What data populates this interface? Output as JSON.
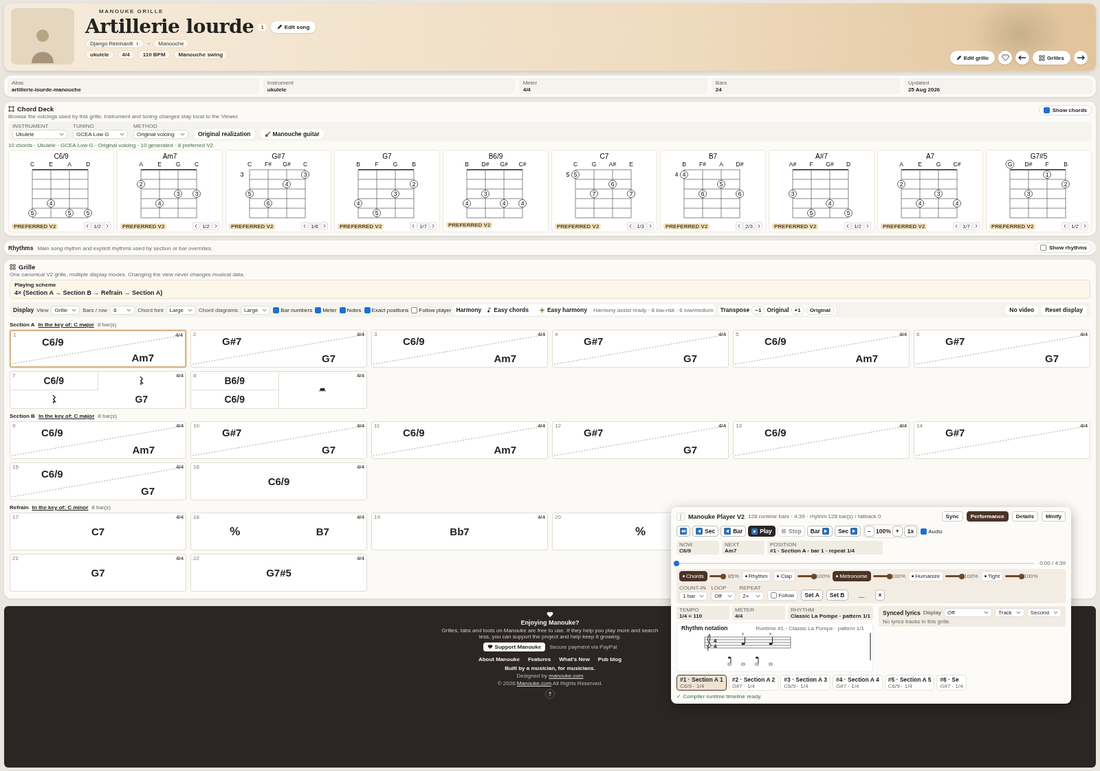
{
  "header": {
    "kicker": "MANOUKE GRILLE",
    "title": "Artillerie lourde",
    "version": "1",
    "edit_song": "Edit song",
    "artist": "Django Reinhardt",
    "artist_info": "i",
    "style": "Manouche",
    "tags": [
      "ukulele",
      "4/4",
      "110 BPM",
      "Manouche swing"
    ],
    "edit_grille": "Edit grille",
    "favorite": false,
    "grilles": "Grilles"
  },
  "meta": [
    {
      "label": "Alias",
      "value": "artillerie-lourde-manouche"
    },
    {
      "label": "Instrument",
      "value": "ukulele"
    },
    {
      "label": "Meter",
      "value": "4/4"
    },
    {
      "label": "Bars",
      "value": "24"
    },
    {
      "label": "Updated",
      "value": "25 Aug 2026"
    }
  ],
  "chord_deck": {
    "title": "Chord Deck",
    "description": "Browse the voicings used by this grille. Instrument and tuning changes stay local to the Viewer.",
    "show_chords": {
      "label": "Show chords",
      "checked": true
    },
    "filters": [
      {
        "label": "INSTRUMENT",
        "value": "Ukulele"
      },
      {
        "label": "TUNING",
        "value": "GCEA Low G"
      },
      {
        "label": "METHOD",
        "value": "Original voicing"
      }
    ],
    "buttons": [
      "Original realization",
      "Manouche guitar"
    ],
    "summary": "10 chords · Ukulele · GCEA Low G · Original voicing · 10 generated · 8 preferred V2",
    "chords": [
      {
        "name": "C6/9",
        "strings": [
          {
            "note": "C",
            "open": false,
            "fret": "5"
          },
          {
            "note": "E",
            "open": false,
            "fret": "4"
          },
          {
            "note": "A",
            "open": false,
            "fret": "5"
          },
          {
            "note": "D",
            "open": false,
            "fret": "5"
          }
        ],
        "badge": "PREFERRED V2",
        "pager": "1/2"
      },
      {
        "name": "Am7",
        "strings": [
          {
            "note": "A",
            "open": false,
            "fret": "2"
          },
          {
            "note": "E",
            "open": false,
            "fret": "4"
          },
          {
            "note": "G",
            "open": false,
            "fret": "3"
          },
          {
            "note": "C",
            "open": false,
            "fret": "3"
          }
        ],
        "badge": "PREFERRED V2",
        "pager": "1/2"
      },
      {
        "name": "G#7",
        "base_fret": "3",
        "strings": [
          {
            "note": "C",
            "open": false,
            "fret": "5"
          },
          {
            "note": "F#",
            "open": false,
            "fret": "6"
          },
          {
            "note": "G#",
            "open": false,
            "fret": "4"
          },
          {
            "note": "C",
            "open": false,
            "fret": "3"
          }
        ],
        "badge": "PREFERRED V2",
        "pager": "1/6"
      },
      {
        "name": "G7",
        "strings": [
          {
            "note": "B",
            "open": false,
            "fret": "4"
          },
          {
            "note": "F",
            "open": false,
            "fret": "5"
          },
          {
            "note": "G",
            "open": false,
            "fret": "3"
          },
          {
            "note": "B",
            "open": false,
            "fret": "2"
          }
        ],
        "badge": "PREFERRED V2",
        "pager": "1/7"
      },
      {
        "name": "B6/9",
        "strings": [
          {
            "note": "B",
            "open": false,
            "fret": "4"
          },
          {
            "note": "D#",
            "open": false,
            "fret": "3"
          },
          {
            "note": "G#",
            "open": false,
            "fret": "4"
          },
          {
            "note": "C#",
            "open": false,
            "fret": "4"
          }
        ],
        "badge": "PREFERRED V2"
      },
      {
        "name": "C7",
        "base_fret": "5",
        "strings": [
          {
            "note": "C",
            "open": false,
            "fret": "5"
          },
          {
            "note": "G",
            "open": false,
            "fret": "7"
          },
          {
            "note": "A#",
            "open": false,
            "fret": "6"
          },
          {
            "note": "E",
            "open": false,
            "fret": "7"
          }
        ],
        "badge": "PREFERRED V2",
        "pager": "1/3"
      },
      {
        "name": "B7",
        "base_fret": "4",
        "strings": [
          {
            "note": "B",
            "open": false,
            "fret": "4"
          },
          {
            "note": "F#",
            "open": false,
            "fret": "6"
          },
          {
            "note": "A",
            "open": false,
            "fret": "5"
          },
          {
            "note": "D#",
            "open": false,
            "fret": "6"
          }
        ],
        "badge": "PREFERRED V2",
        "pager": "2/3"
      },
      {
        "name": "A#7",
        "strings": [
          {
            "note": "A#",
            "open": false,
            "fret": "3"
          },
          {
            "note": "F",
            "open": false,
            "fret": "5"
          },
          {
            "note": "G#",
            "open": false,
            "fret": "4"
          },
          {
            "note": "D",
            "open": false,
            "fret": "5"
          }
        ],
        "badge": "PREFERRED V2",
        "pager": "1/2"
      },
      {
        "name": "A7",
        "strings": [
          {
            "note": "A",
            "open": false,
            "fret": "2"
          },
          {
            "note": "E",
            "open": false,
            "fret": "4"
          },
          {
            "note": "G",
            "open": false,
            "fret": "3"
          },
          {
            "note": "C#",
            "open": false,
            "fret": "4"
          }
        ],
        "badge": "PREFERRED V2",
        "pager": "1/7"
      },
      {
        "name": "G7#5",
        "strings": [
          {
            "note": "G",
            "open": true
          },
          {
            "note": "D#",
            "open": false,
            "fret": "3"
          },
          {
            "note": "F",
            "open": false,
            "fret": "1"
          },
          {
            "note": "B",
            "open": false,
            "fret": "2"
          }
        ],
        "badge": "PREFERRED V2",
        "pager": "1/2"
      }
    ]
  },
  "rhythms": {
    "title": "Rhythms",
    "description": "Main song rhythm and explicit rhythms used by section or bar overrides.",
    "show_rhythms": {
      "label": "Show rhythms",
      "checked": false
    }
  },
  "grille": {
    "title": "Grille",
    "description": "One canonical V2 grille, multiple display modes. Changing the view never changes musical data.",
    "scheme_label": "Playing scheme",
    "scheme": "4× (Section A → Section B → Refrain → Section A)",
    "display": {
      "label": "Display",
      "selects": [
        {
          "label": "View",
          "value": "Grille"
        },
        {
          "label": "Bars / row",
          "value": "6"
        },
        {
          "label": "Chord font",
          "value": "Large"
        },
        {
          "label": "Chord diagrams",
          "value": "Large"
        }
      ],
      "checks": [
        {
          "label": "Bar numbers",
          "checked": true
        },
        {
          "label": "Meter",
          "checked": true
        },
        {
          "label": "Notes",
          "checked": true
        },
        {
          "label": "Exact positions",
          "checked": true
        },
        {
          "label": "Follow player",
          "checked": false
        }
      ]
    },
    "harmony": {
      "label": "Harmony",
      "easy_chords": "Easy chords",
      "easy_harmony": "Easy harmony",
      "note": "Harmony assist ready · 8 low-risk · 6 low/medium"
    },
    "transpose": {
      "label": "Transpose",
      "minus": "−1",
      "current": "Original",
      "plus": "+1",
      "reset": "Original"
    },
    "right_buttons": [
      "No video",
      "Reset display"
    ],
    "sections": [
      {
        "name": "Section A",
        "key_label": "In the key of:",
        "key": "C major",
        "count": "8 bar(s)",
        "rows": [
          [
            {
              "number": "1",
              "meter": "4/4",
              "kind": "split",
              "chords": [
                "C6/9",
                "Am7"
              ],
              "selected": true
            },
            {
              "number": "2",
              "meter": "4/4",
              "kind": "split",
              "chords": [
                "G#7",
                "G7"
              ],
              "selected": false
            },
            {
              "number": "3",
              "meter": "4/4",
              "kind": "split",
              "chords": [
                "C6/9",
                "Am7"
              ],
              "selected": false
            },
            {
              "number": "4",
              "meter": "4/4",
              "kind": "split",
              "chords": [
                "G#7",
                "G7"
              ],
              "selected": false
            },
            {
              "number": "5",
              "meter": "4/4",
              "kind": "split",
              "chords": [
                "C6/9",
                "Am7"
              ],
              "selected": false
            },
            {
              "number": "6",
              "meter": "4/4",
              "kind": "split",
              "chords": [
                "G#7",
                "G7"
              ],
              "selected": false
            }
          ],
          [
            {
              "number": "7",
              "meter": "4/4",
              "kind": "quad",
              "cells": [
                {
                  "kind": "chord",
                  "chord": "C6/9"
                },
                {
                  "kind": "rest"
                },
                {
                  "kind": "rest"
                },
                {
                  "kind": "chord",
                  "chord": "G7"
                }
              ],
              "selected": false
            },
            {
              "number": "8",
              "meter": "4/4",
              "kind": "stack",
              "chords": [
                "B6/9",
                "C6/9"
              ],
              "right": {
                "kind": "half-rest"
              },
              "selected": false
            }
          ]
        ]
      },
      {
        "name": "Section B",
        "key_label": "In the key of:",
        "key": "C major",
        "count": "8 bar(s)",
        "rows": [
          [
            {
              "number": "9",
              "meter": "4/4",
              "kind": "split",
              "chords": [
                "C6/9",
                "Am7"
              ],
              "selected": false
            },
            {
              "number": "10",
              "meter": "4/4",
              "kind": "split",
              "chords": [
                "G#7",
                "G7"
              ],
              "selected": false
            },
            {
              "number": "11",
              "meter": "4/4",
              "kind": "split",
              "chords": [
                "C6/9",
                "Am7"
              ],
              "selected": false
            },
            {
              "number": "12",
              "meter": "4/4",
              "kind": "split",
              "chords": [
                "G#7",
                "G7"
              ],
              "selected": false
            },
            {
              "number": "13",
              "meter": "4/4",
              "kind": "split",
              "chords": [
                "C6/9"
              ],
              "selected": false
            },
            {
              "number": "14",
              "meter": "4/4",
              "kind": "split",
              "chords": [
                "G#7"
              ],
              "selected": false
            }
          ],
          [
            {
              "number": "15",
              "meter": "4/4",
              "kind": "split",
              "chords": [
                "C6/9",
                "G7"
              ],
              "selected": false
            },
            {
              "number": "16",
              "meter": "4/4",
              "kind": "single",
              "chord": "C6/9",
              "selected": false
            }
          ]
        ]
      },
      {
        "name": "Refrain",
        "key_label": "In the key of:",
        "key": "C minor",
        "count": "8 bar(s)",
        "rows": [
          [
            {
              "number": "17",
              "meter": "4/4",
              "kind": "single",
              "chord": "C7",
              "selected": false
            },
            {
              "number": "18",
              "meter": "4/4",
              "kind": "repeat-then",
              "symbol": "%",
              "chord": "B7",
              "selected": false
            },
            {
              "number": "19",
              "meter": "4/4",
              "kind": "single",
              "chord": "Bb7",
              "selected": false
            },
            {
              "number": "20",
              "kind": "repeat",
              "symbol": "%",
              "selected": false
            }
          ],
          [
            {
              "number": "21",
              "meter": "4/4",
              "kind": "single",
              "chord": "G7",
              "selected": false
            },
            {
              "number": "22",
              "meter": "4/4",
              "kind": "single",
              "chord": "G7#5",
              "selected": false
            }
          ]
        ]
      }
    ]
  },
  "player": {
    "title": "Manouke Player V2",
    "subtitle": "128 runtime bars · 4:39 · rhythm 128 bar(s) / fallback 0",
    "modes": [
      {
        "label": "Sync",
        "selected": false
      },
      {
        "label": "Performance",
        "selected": true
      },
      {
        "label": "Details",
        "selected": false
      },
      {
        "label": "Minify",
        "selected": false
      }
    ],
    "transport": [
      {
        "kind": "start"
      },
      {
        "kind": "back",
        "label": "Sec"
      },
      {
        "kind": "back",
        "label": "Bar"
      },
      {
        "kind": "play",
        "label": "Play"
      },
      {
        "kind": "stop",
        "label": "Stop"
      },
      {
        "kind": "forward",
        "label": "Bar"
      },
      {
        "kind": "forward",
        "label": "Sec"
      }
    ],
    "speed": {
      "minus": "−",
      "value": "100%",
      "plus": "+",
      "rate": "1x"
    },
    "audio": {
      "label": "Audio",
      "checked": true
    },
    "now": [
      {
        "label": "NOW",
        "value": "C6/9"
      },
      {
        "label": "NEXT",
        "value": "Am7"
      },
      {
        "label": "POSITION",
        "value": "#1 · Section A · bar 1 · repeat 1/4"
      }
    ],
    "progress": {
      "level": 0.0,
      "time": "0:00 / 4:39"
    },
    "mixer": [
      {
        "label": "Chords",
        "on": true,
        "level": 0.85,
        "reading": "85%"
      },
      {
        "label": "Rhythm",
        "on": false
      },
      {
        "label": "Clap",
        "on": false,
        "level": 1.0,
        "reading": "100%"
      },
      {
        "label": "Metronome",
        "on": true,
        "level": 1.0,
        "reading": "100%"
      },
      {
        "label": "Humanize",
        "on": false,
        "level": 1.0,
        "reading": "100%"
      },
      {
        "label": "Tight",
        "on": false,
        "level": 1.0,
        "reading": "100%"
      }
    ],
    "options": [
      {
        "label": "COUNT-IN",
        "value": "1 bar"
      },
      {
        "label": "LOOP",
        "value": "Off"
      },
      {
        "label": "REPEAT",
        "value": "2×"
      }
    ],
    "follow": {
      "label": "Follow",
      "checked": false
    },
    "set_a": "Set A",
    "set_b": "Set B",
    "loop_range": "—",
    "clear": "×",
    "info": [
      {
        "label": "TEMPO",
        "value": "1/4 = 110"
      },
      {
        "label": "METER",
        "value": "4/4"
      },
      {
        "label": "RHYTHM",
        "value": "Classic La Pompe · pattern 1/1"
      }
    ],
    "lyrics": {
      "title": "Synced lyrics",
      "display_label": "Display",
      "display": "Off",
      "track": "Track",
      "second": "Second",
      "empty": "No lyrics tracks in this grille."
    },
    "notation": {
      "title": "Rhythm notation",
      "caption": "Runtime #1 · Classic La Pompe · pattern 1/1",
      "time_signature": [
        "4",
        "4"
      ]
    },
    "bars": [
      {
        "label": "#1 · Section A 1",
        "sub": "C6/9 · 1/4",
        "selected": true
      },
      {
        "label": "#2 · Section A 2",
        "sub": "G#7 · 1/4",
        "selected": false
      },
      {
        "label": "#3 · Section A 3",
        "sub": "C6/9 · 1/4",
        "selected": false
      },
      {
        "label": "#4 · Section A 4",
        "sub": "G#7 · 1/4",
        "selected": false
      },
      {
        "label": "#5 · Section A 5",
        "sub": "C6/9 · 1/4",
        "selected": false
      },
      {
        "label": "#6 · Se",
        "sub": "G#7 · 1/4",
        "selected": false
      }
    ],
    "status": "✓ Compiler runtime timeline ready."
  },
  "footer": {
    "title": "Enjoying Manouke?",
    "text": "Grilles, tabs and tools on Manouke are free to use. If they help you play more and search less, you can support the project and help keep it growing.",
    "support": "Support Manouke",
    "payment": "Secure payment via PayPal",
    "links": [
      "About Manouke",
      "Features",
      "What's New",
      "Pub blog"
    ],
    "built": "Built by a musician, for musicians.",
    "designed": "Designed by",
    "designed_link": "manouke.com",
    "copyright": "© 2026",
    "copyright_link": "Manouke.com",
    "rights": "All Rights Reserved."
  }
}
